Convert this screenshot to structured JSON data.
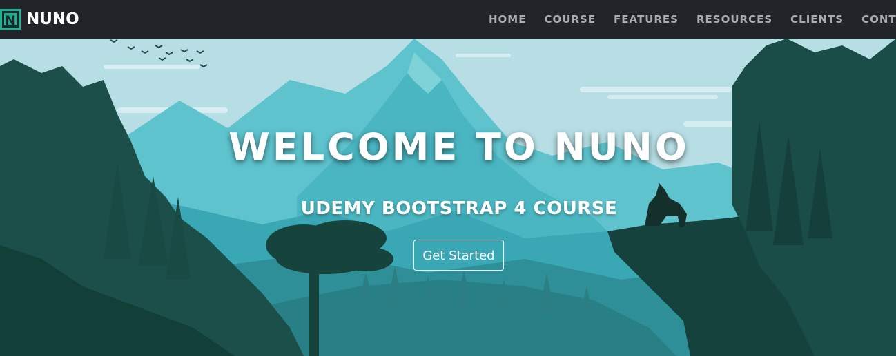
{
  "brand": {
    "logo_letter": "N",
    "name": "NUNO"
  },
  "nav": {
    "items": [
      {
        "label": "HOME"
      },
      {
        "label": "COURSE"
      },
      {
        "label": "FEATURES"
      },
      {
        "label": "RESOURCES"
      },
      {
        "label": "CLIENTS"
      },
      {
        "label": "CONTA"
      }
    ]
  },
  "hero": {
    "title": "WELCOME TO NUNO",
    "subtitle": "UDEMY BOOTSTRAP 4 COURSE",
    "button_label": "Get Started"
  },
  "colors": {
    "navbar_bg": "#212529",
    "nav_link": "#a9acaf",
    "logo_accent": "#1ab394",
    "sky": "#b5dde3",
    "mountain": "#4fbfc9",
    "forest_dark": "#123f38"
  }
}
